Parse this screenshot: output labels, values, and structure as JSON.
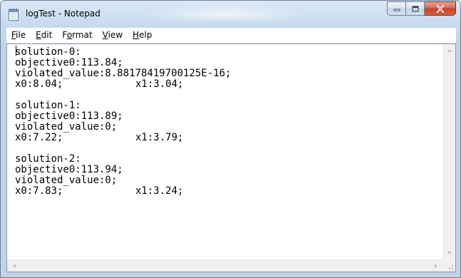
{
  "window": {
    "title": "logTest - Notepad",
    "icon": "notepad-icon",
    "buttons": [
      "minimize-icon",
      "maximize-icon",
      "close-icon"
    ]
  },
  "menu": {
    "items": [
      {
        "accel": "F",
        "rest": "ile"
      },
      {
        "accel": "E",
        "rest": "dit"
      },
      {
        "pre": "F",
        "accel": "o",
        "rest": "rmat"
      },
      {
        "accel": "V",
        "rest": "iew"
      },
      {
        "accel": "H",
        "rest": "elp"
      }
    ]
  },
  "document": {
    "solutions": [
      {
        "header": "solution-0:",
        "objective": "objective0:113.84;",
        "violated": "violated_value:8.88178419700125E-16;",
        "x0": "x0:8.04;",
        "x1": "x1:3.04;"
      },
      {
        "header": "solution-1:",
        "objective": "objective0:113.89;",
        "violated": "violated_value:0;",
        "x0": "x0:7.22;",
        "x1": "x1:3.79;"
      },
      {
        "header": "solution-2:",
        "objective": "objective0:113.94;",
        "violated": "violated_value:0;",
        "x0": "x0:7.83;",
        "x1": "x1:3.24;"
      }
    ]
  },
  "colors": {
    "frame": "#bfd3ea",
    "close_button": "#c2442d",
    "editor_bg": "#ffffff"
  }
}
